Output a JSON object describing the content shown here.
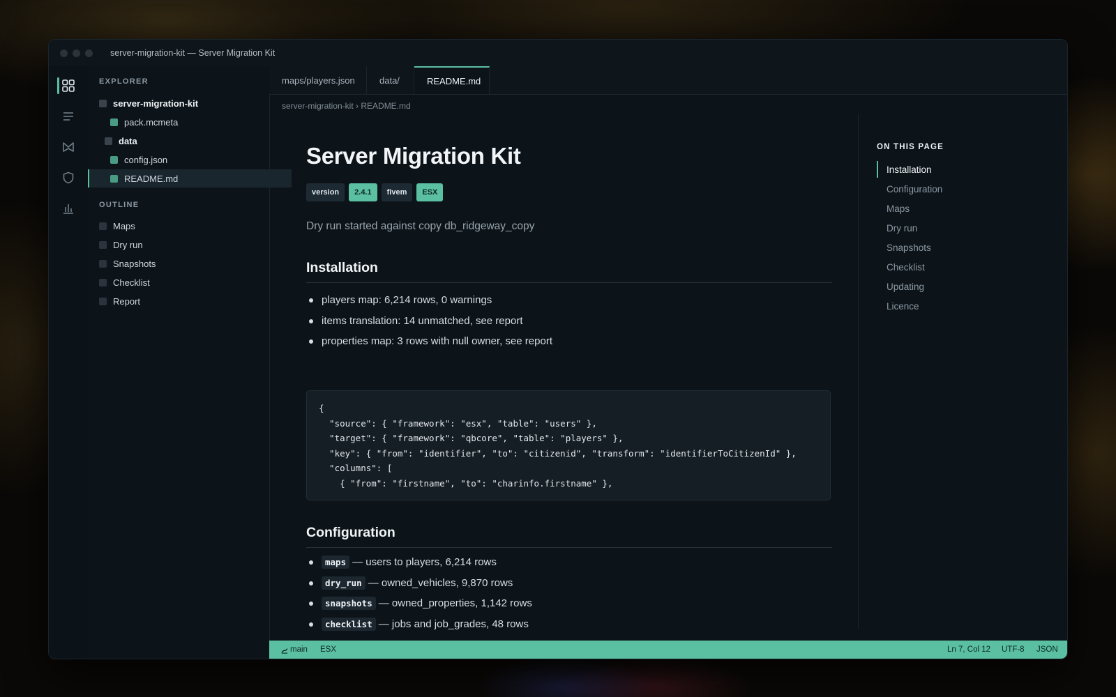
{
  "window": {
    "title": "server-migration-kit — Server Migration Kit"
  },
  "activity_bar": {
    "items": [
      {
        "icon": "grid-icon",
        "active": true
      },
      {
        "icon": "list-icon",
        "active": false
      },
      {
        "icon": "badge-icon",
        "active": false
      },
      {
        "icon": "shield-icon",
        "active": false
      },
      {
        "icon": "bar-chart-icon",
        "active": false
      }
    ]
  },
  "sidebar": {
    "explorer_title": "EXPLORER",
    "explorer": [
      {
        "label": "server-migration-kit",
        "type": "folder"
      },
      {
        "label": "pack.mcmeta",
        "type": "file"
      },
      {
        "label": "data",
        "type": "folder"
      },
      {
        "label": "config.json",
        "type": "file"
      },
      {
        "label": "README.md",
        "type": "file",
        "selected": true
      }
    ],
    "outline_title": "OUTLINE",
    "outline": [
      "Maps",
      "Dry run",
      "Snapshots",
      "Checklist",
      "Report"
    ]
  },
  "tabs": [
    {
      "label": "maps/players.json"
    },
    {
      "label": "data/"
    },
    {
      "label": "README.md",
      "active": true
    }
  ],
  "breadcrumb": "server-migration-kit › README.md",
  "doc": {
    "title": "Server Migration Kit",
    "badges": [
      {
        "label": "version",
        "style": "dark"
      },
      {
        "label": "2.4.1",
        "style": "green"
      },
      {
        "label": "fivem",
        "style": "dark"
      },
      {
        "label": "ESX",
        "style": "green"
      }
    ],
    "lede": "Dry run started against copy db_ridgeway_copy",
    "installation": {
      "heading": "Installation",
      "bullets": [
        "players map: 6,214 rows, 0 warnings",
        "items translation: 14 unmatched, see report",
        "properties map: 3 rows with null owner, see report"
      ],
      "code": "{\n  \"source\": { \"framework\": \"esx\", \"table\": \"users\" },\n  \"target\": { \"framework\": \"qbcore\", \"table\": \"players\" },\n  \"key\": { \"from\": \"identifier\", \"to\": \"citizenid\", \"transform\": \"identifierToCitizenId\" },\n  \"columns\": [\n    { \"from\": \"firstname\", \"to\": \"charinfo.firstname\" },"
    },
    "configuration": {
      "heading": "Configuration",
      "items": [
        {
          "code": "maps",
          "text": "— users to players, 6,214 rows"
        },
        {
          "code": "dry_run",
          "text": "— owned_vehicles, 9,870 rows"
        },
        {
          "code": "snapshots",
          "text": "— owned_properties, 1,142 rows"
        },
        {
          "code": "checklist",
          "text": "— jobs and job_grades, 48 rows"
        }
      ]
    }
  },
  "toc": {
    "title": "ON THIS PAGE",
    "items": [
      "Installation",
      "Configuration",
      "Maps",
      "Dry run",
      "Snapshots",
      "Checklist",
      "Updating",
      "Licence"
    ],
    "active": "Installation"
  },
  "statusbar": {
    "branch": "main",
    "framework": "ESX",
    "position": "Ln 7, Col 12",
    "encoding": "UTF-8",
    "language": "JSON"
  },
  "colors": {
    "accent": "#5bbfa1",
    "background": "#0d1419"
  }
}
